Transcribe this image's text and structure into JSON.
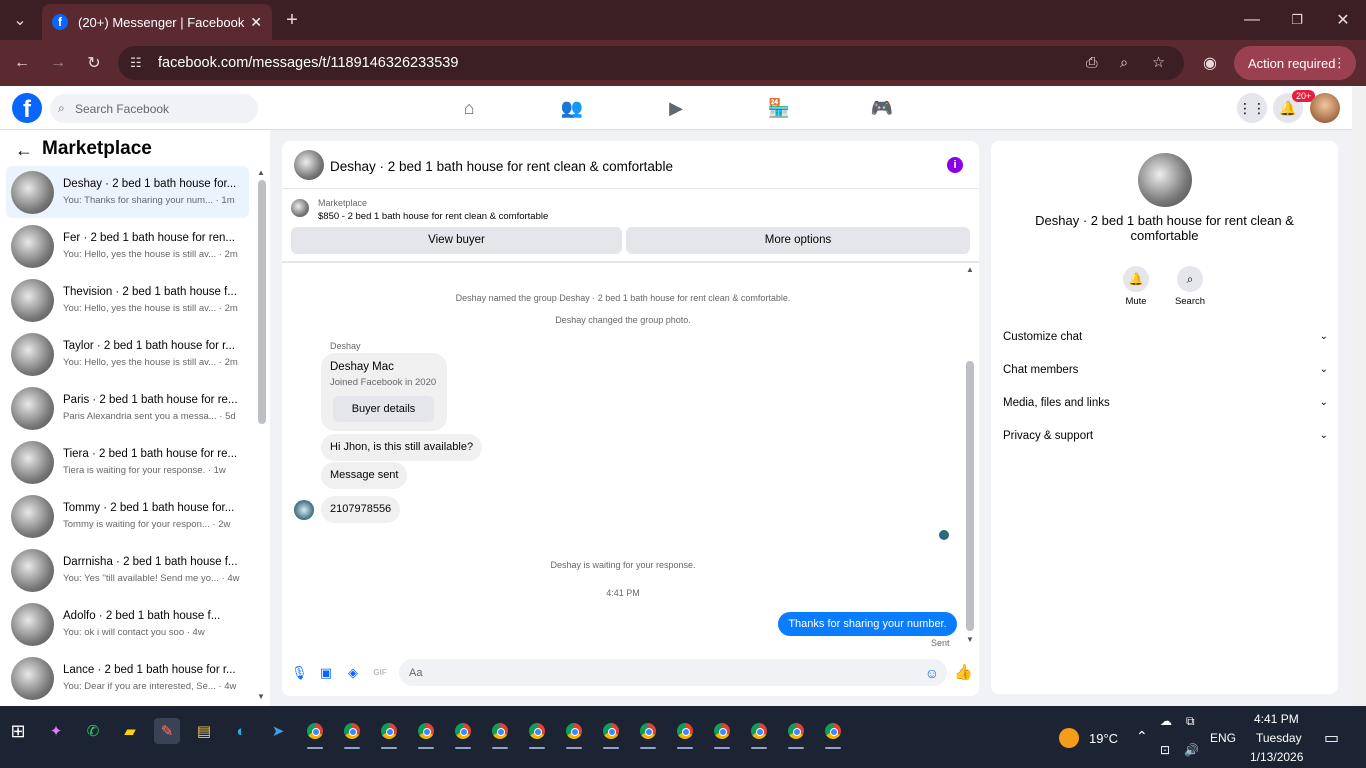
{
  "browser": {
    "tab_title": "(20+) Messenger | Facebook",
    "url": "facebook.com/messages/t/1189146326233539",
    "action_required": "Action required"
  },
  "fb_nav": {
    "logo": "f",
    "search_placeholder": "Search Facebook",
    "notification_badge": "20+"
  },
  "sidebar": {
    "title": "Marketplace",
    "conversations": [
      {
        "title": "Deshay · 2 bed 1 bath house for...",
        "snippet": "You: Thanks for sharing your num... · 1m"
      },
      {
        "title": "Fer · 2 bed 1 bath house for ren...",
        "snippet": "You: Hello, yes the house is still av... · 2m"
      },
      {
        "title": "Thevision · 2 bed 1 bath house f...",
        "snippet": "You: Hello, yes the house is still av... · 2m"
      },
      {
        "title": "Taylor · 2 bed 1 bath house for r...",
        "snippet": "You: Hello, yes the house is still av... · 2m"
      },
      {
        "title": "Paris · 2 bed 1 bath house for re...",
        "snippet": "Paris Alexandria sent you a messa... · 5d"
      },
      {
        "title": "Tiera · 2 bed 1 bath house for re...",
        "snippet": "Tiera is waiting for your response. · 1w"
      },
      {
        "title": "Tommy · 2 bed 1 bath house for...",
        "snippet": "Tommy is waiting for your respon... · 2w"
      },
      {
        "title": "Darrnisha · 2 bed 1 bath house f...",
        "snippet": "You: Yes ''till available! Send me yo... · 4w"
      },
      {
        "title": "Adolfo · 2 bed 1 bath house f...",
        "snippet": "You: ok i will contact you soo · 4w"
      },
      {
        "title": "Lance · 2 bed 1 bath house for r...",
        "snippet": "You: Dear if you are interested, Se... · 4w"
      }
    ]
  },
  "chat": {
    "title": "Deshay · 2 bed 1 bath house for rent clean & comfortable",
    "marketplace_label": "Marketplace",
    "listing": "$850 - 2 bed 1 bath house for rent clean & comfortable",
    "view_buyer": "View buyer",
    "more_options": "More options",
    "system_1": "Deshay named the group Deshay · 2 bed 1 bath house for rent clean & comfortable.",
    "system_2": "Deshay changed the group photo.",
    "sender_name": "Deshay",
    "card_name": "Deshay Mac",
    "card_sub": "Joined Facebook in 2020",
    "buyer_details": "Buyer details",
    "msg_1": "Hi Jhon, is this still available?",
    "msg_2": "Message sent",
    "msg_3": "2107978556",
    "waiting": "Deshay is waiting for your response.",
    "time": "4:41 PM",
    "my_msg": "Thanks for sharing your number.",
    "my_status": "Sent",
    "composer_placeholder": "Aa"
  },
  "details": {
    "title": "Deshay · 2 bed 1 bath house for rent clean & comfortable",
    "mute": "Mute",
    "search": "Search",
    "rows": [
      "Customize chat",
      "Chat members",
      "Media, files and links",
      "Privacy & support"
    ]
  },
  "taskbar": {
    "temperature": "19°C",
    "language": "ENG",
    "clock_time": "4:41 PM",
    "clock_day": "Tuesday",
    "clock_date": "1/13/2026"
  }
}
